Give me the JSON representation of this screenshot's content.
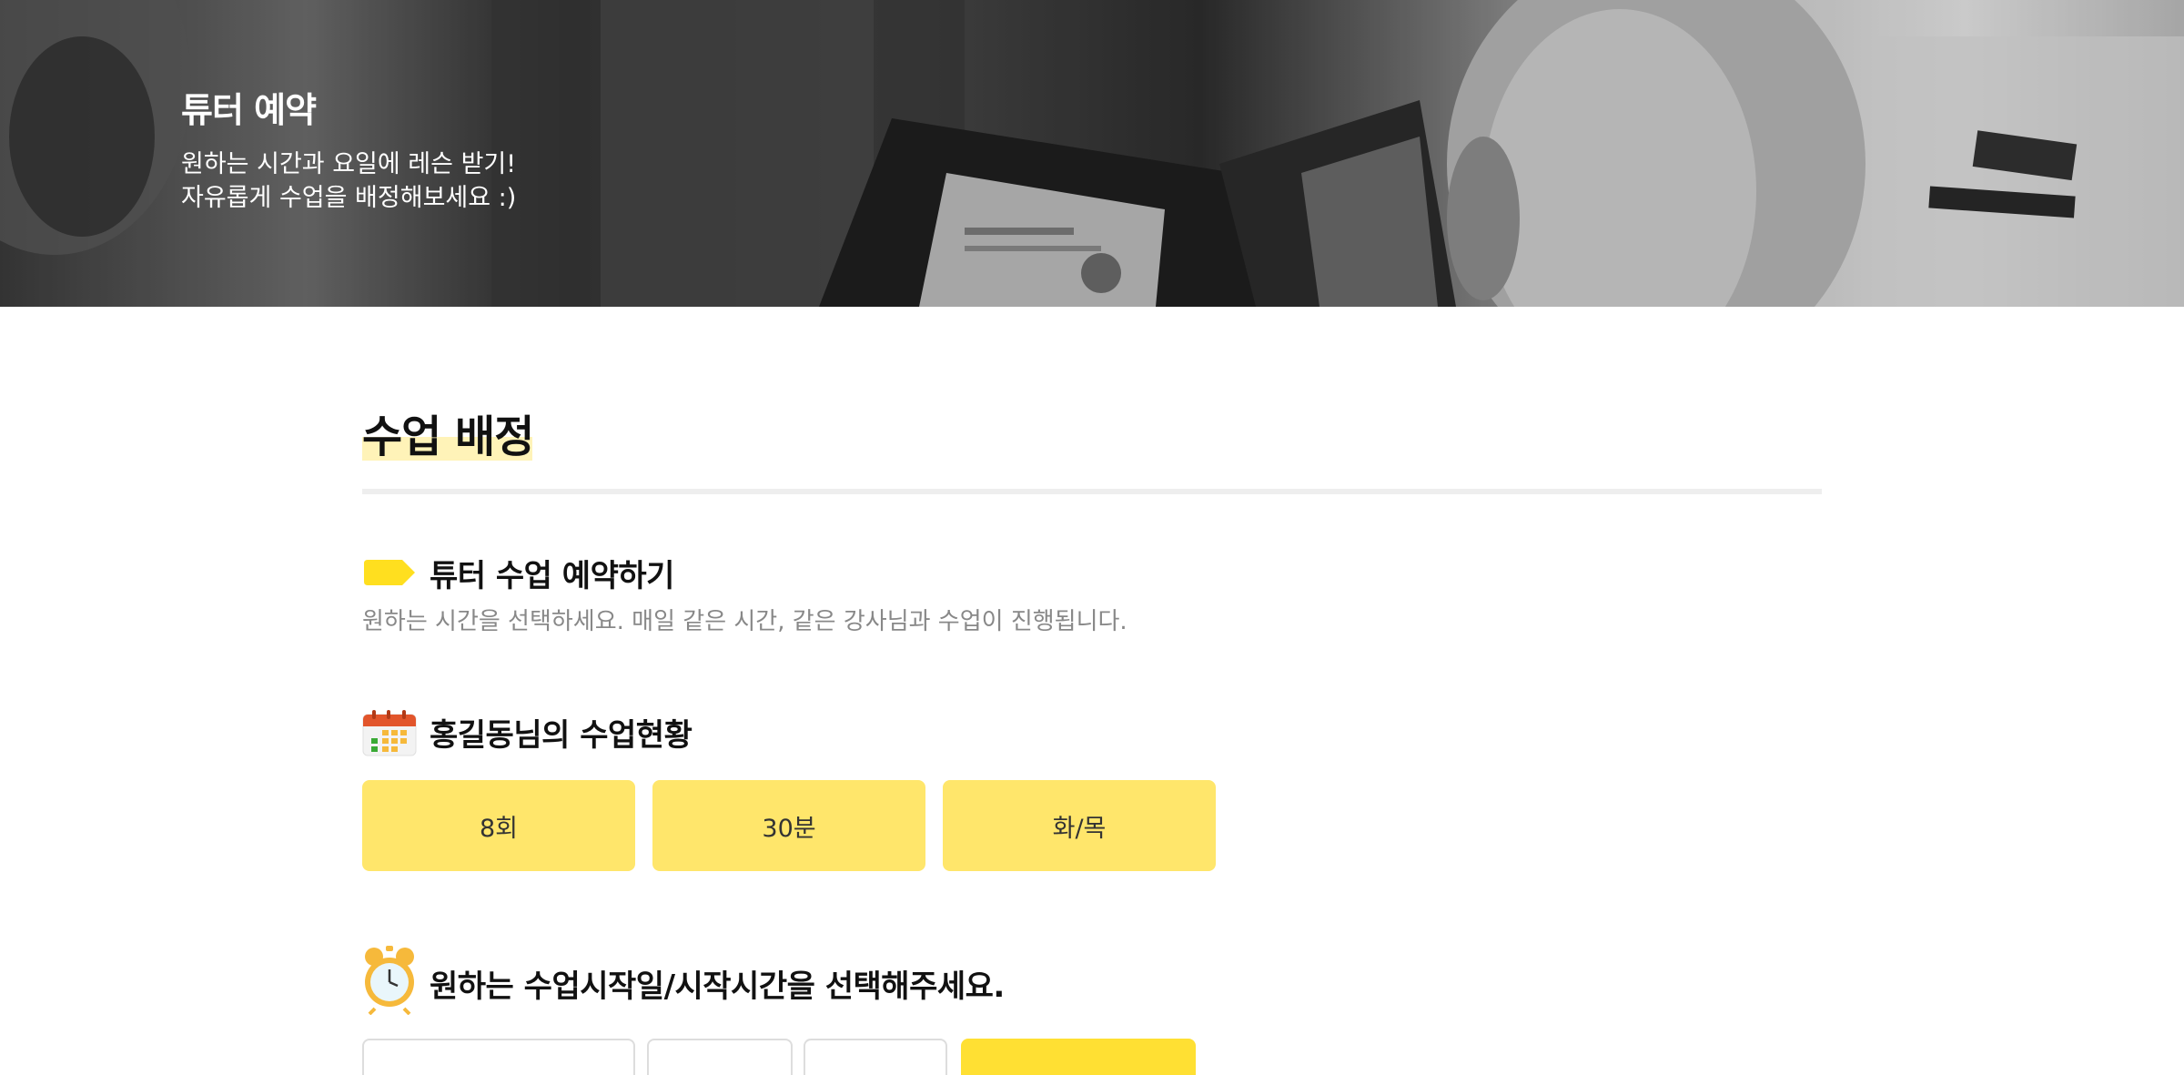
{
  "hero": {
    "title": "튜터 예약",
    "subtitle_line1": "원하는 시간과 요일에 레슨 받기!",
    "subtitle_line2": "자유롭게 수업을 배정해보세요 :)"
  },
  "page": {
    "title": "수업 배정"
  },
  "booking_section": {
    "icon": "tag-icon",
    "title": "튜터 수업 예약하기",
    "description": "원하는 시간을 선택하세요. 매일 같은 시간, 같은 강사님과 수업이 진행됩니다."
  },
  "status_section": {
    "icon": "calendar-icon",
    "title": "홍길동님의 수업현황",
    "stats": [
      {
        "value": "8회"
      },
      {
        "value": "30분"
      },
      {
        "value": "화/목"
      }
    ]
  },
  "start_section": {
    "icon": "alarm-clock-icon",
    "title": "원하는 수업시작일/시작시간을 선택해주세요."
  },
  "colors": {
    "accent": "#ffe66b",
    "accent_strong": "#ffe033",
    "title_highlight": "#fff3b8",
    "muted_text": "#888888"
  }
}
